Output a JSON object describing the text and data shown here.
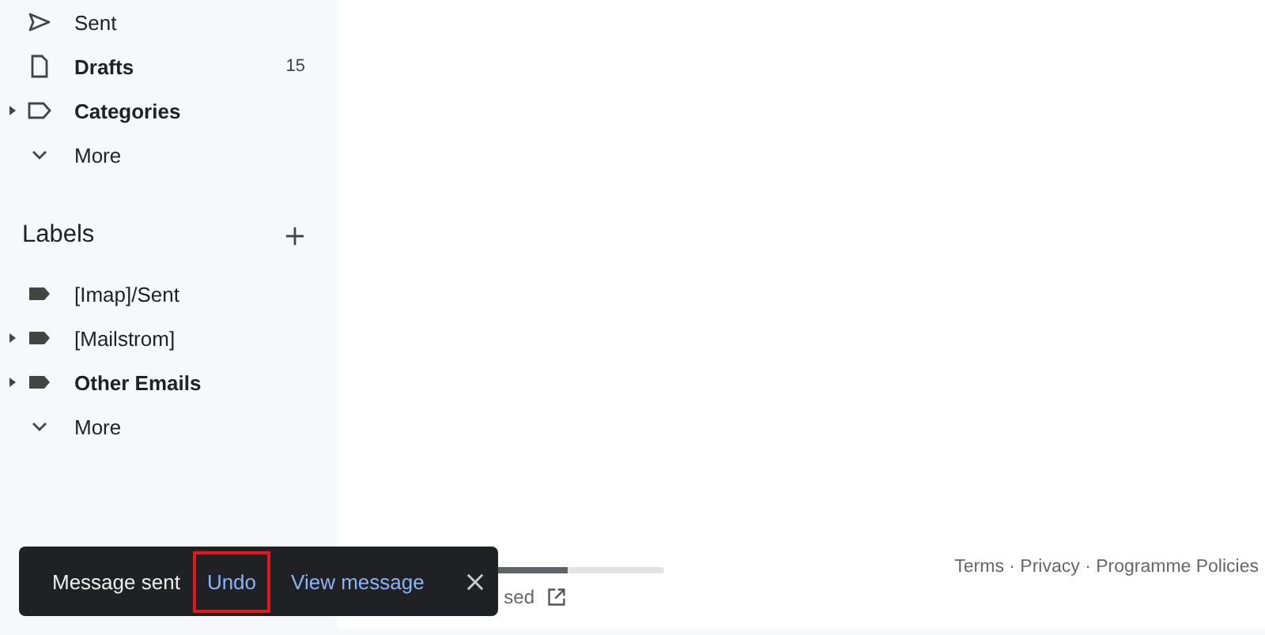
{
  "sidebar": {
    "items": [
      {
        "label": "Sent",
        "kind": "sent",
        "bold": false,
        "expander": false
      },
      {
        "label": "Drafts",
        "kind": "draft",
        "bold": true,
        "expander": false,
        "count": "15"
      },
      {
        "label": "Categories",
        "kind": "category",
        "bold": true,
        "expander": true
      },
      {
        "label": "More",
        "kind": "more",
        "bold": false,
        "expander": false
      }
    ],
    "labels_heading": "Labels",
    "labels": [
      {
        "label": "[Imap]/Sent",
        "kind": "label",
        "bold": false,
        "expander": false
      },
      {
        "label": "[Mailstrom]",
        "kind": "label",
        "bold": false,
        "expander": true
      },
      {
        "label": "Other Emails",
        "kind": "label",
        "bold": true,
        "expander": true
      },
      {
        "label": "More",
        "kind": "more",
        "bold": false,
        "expander": false
      }
    ]
  },
  "storage": {
    "level": 0.7,
    "text": "sed"
  },
  "footer_links": "Terms · Privacy · Programme Policies",
  "snackbar": {
    "message": "Message sent",
    "actions": [
      {
        "label": "Undo",
        "highlighted": true
      },
      {
        "label": "View message",
        "highlighted": false
      }
    ]
  }
}
